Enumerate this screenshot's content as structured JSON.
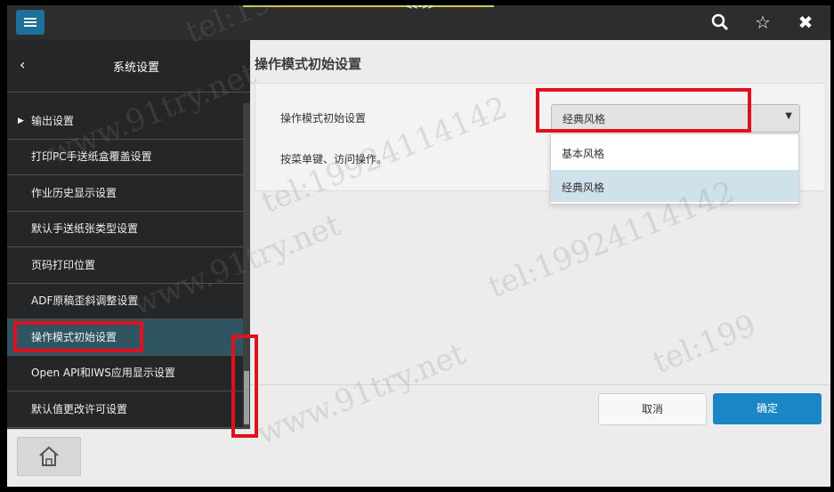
{
  "topbar": {
    "indicator": "<<•>>",
    "icons": [
      "menu-icon",
      "search-icon",
      "star-icon",
      "close-icon"
    ]
  },
  "left_panel": {
    "title": "系统设置",
    "items": [
      {
        "label": "输出设置",
        "has_arrow": true
      },
      {
        "label": "打印PC手送纸盒覆盖设置"
      },
      {
        "label": "作业历史显示设置"
      },
      {
        "label": "默认手送纸张类型设置"
      },
      {
        "label": "页码打印位置"
      },
      {
        "label": "ADF原稿歪斜调整设置"
      },
      {
        "label": "操作模式初始设置",
        "selected": true
      },
      {
        "label": "Open API和IWS应用显示设置"
      },
      {
        "label": "默认值更改许可设置"
      }
    ]
  },
  "main": {
    "title": "操作模式初始设置",
    "field_label": "操作模式初始设置",
    "selected_value": "经典风格",
    "hint": "按菜单键、访问操作。",
    "options": [
      {
        "label": "基本风格"
      },
      {
        "label": "经典风格",
        "active": true
      }
    ],
    "cancel_label": "取消",
    "ok_label": "确定"
  },
  "watermark": {
    "tel": "tel:19924114142",
    "site": "www.91try.net",
    "fragment": "tel:199"
  },
  "colors": {
    "accent_blue": "#1a86c6",
    "highlight_red": "#e0101c",
    "dark_panel": "#242627"
  }
}
